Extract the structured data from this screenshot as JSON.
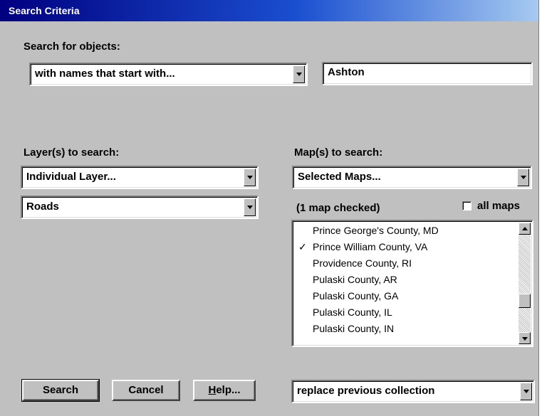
{
  "window": {
    "title": "Search Criteria"
  },
  "search": {
    "label": "Search for objects:",
    "mode": "with names that start with...",
    "query": "Ashton"
  },
  "layers": {
    "label": "Layer(s) to search:",
    "scope": "Individual Layer...",
    "layer": "Roads"
  },
  "maps": {
    "label": "Map(s) to search:",
    "scope": "Selected Maps...",
    "checked_count": "(1 map checked)",
    "all_maps_label": "all maps",
    "all_maps_checked": false,
    "items": [
      {
        "name": "Prince George's County, MD",
        "checked": false
      },
      {
        "name": "Prince William County, VA",
        "checked": true
      },
      {
        "name": "Providence County, RI",
        "checked": false
      },
      {
        "name": "Pulaski County, AR",
        "checked": false
      },
      {
        "name": "Pulaski County, GA",
        "checked": false
      },
      {
        "name": "Pulaski County, IL",
        "checked": false
      },
      {
        "name": "Pulaski County, IN",
        "checked": false
      }
    ],
    "check_glyph": "✓"
  },
  "buttons": {
    "search": "Search",
    "cancel": "Cancel",
    "help_h": "H",
    "help_rest": "elp..."
  },
  "collection": {
    "mode": "replace previous collection"
  },
  "colors": {
    "titlebar": "#000080",
    "face": "#c0c0c0"
  }
}
